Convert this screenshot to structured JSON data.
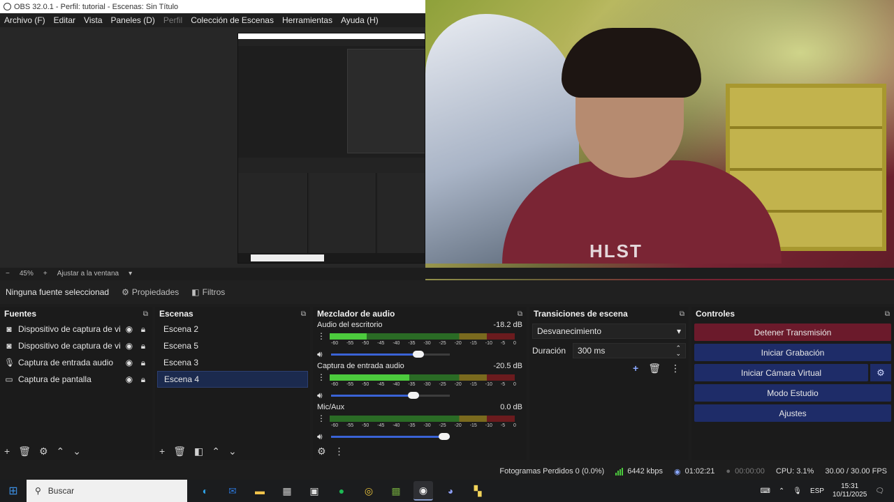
{
  "window": {
    "title": "OBS 32.0.1 - Perfil: tutorial - Escenas: Sin Título"
  },
  "menu": [
    {
      "label": "Archivo (F)",
      "enabled": true
    },
    {
      "label": "Editar",
      "enabled": true
    },
    {
      "label": "Vista",
      "enabled": true
    },
    {
      "label": "Paneles (D)",
      "enabled": true
    },
    {
      "label": "Perfil",
      "enabled": false
    },
    {
      "label": "Colección de Escenas",
      "enabled": true
    },
    {
      "label": "Herramientas",
      "enabled": true
    },
    {
      "label": "Ayuda (H)",
      "enabled": true
    }
  ],
  "zoom": {
    "minus": "−",
    "value": "45%",
    "plus": "+",
    "fit": "Ajustar a la ventana"
  },
  "source_toolbar": {
    "selected": "Ninguna fuente seleccionad",
    "properties": "Propiedades",
    "filters": "Filtros"
  },
  "sources": {
    "title": "Fuentes",
    "items": [
      {
        "label": "Dispositivo de captura de vide",
        "icon": "camera-icon"
      },
      {
        "label": "Dispositivo de captura de vide",
        "icon": "camera-icon"
      },
      {
        "label": "Captura de entrada audio",
        "icon": "microphone-icon"
      },
      {
        "label": "Captura de pantalla",
        "icon": "monitor-icon"
      }
    ]
  },
  "scenes": {
    "title": "Escenas",
    "items": [
      "Escena 2",
      "Escena 5",
      "Escena 3",
      "Escena 4"
    ],
    "active": "Escena 4"
  },
  "mixer": {
    "title": "Mezclador de audio",
    "scale": [
      "-60",
      "-55",
      "-50",
      "-45",
      "-40",
      "-35",
      "-30",
      "-25",
      "-20",
      "-15",
      "-10",
      "-5",
      "0"
    ],
    "channels": [
      {
        "name": "Audio del escritorio",
        "db": "-18.2 dB",
        "level": 0.2,
        "volume": 0.78
      },
      {
        "name": "Captura de entrada audio",
        "db": "-20.5 dB",
        "level": 0.43,
        "volume": 0.74
      },
      {
        "name": "Mic/Aux",
        "db": "0.0 dB",
        "level": 0.0,
        "volume": 1.0
      }
    ]
  },
  "transitions": {
    "title": "Transiciones de escena",
    "selected": "Desvanecimiento",
    "duration_label": "Duración",
    "duration_value": "300 ms"
  },
  "controls": {
    "title": "Controles",
    "stop_stream": "Detener Transmisión",
    "start_record": "Iniciar Grabación",
    "start_vcam": "Iniciar Cámara Virtual",
    "studio_mode": "Modo Estudio",
    "settings": "Ajustes"
  },
  "status": {
    "dropped": "Fotogramas Perdidos 0 (0.0%)",
    "bitrate": "6442 kbps",
    "stream_time": "01:02:21",
    "record_time": "00:00:00",
    "cpu": "CPU: 3.1%",
    "fps": "30.00 / 30.00 FPS"
  },
  "taskbar": {
    "search_placeholder": "Buscar",
    "time": "15:31",
    "date": "10/11/2025",
    "lang": "ESP"
  },
  "preview": {
    "shirt_text": "HLST"
  },
  "colors": {
    "accent": "#1e2c68",
    "stop": "#6b1a2b",
    "active_scene": "#1b2a4e",
    "meter_green": "#4ccb3d"
  }
}
